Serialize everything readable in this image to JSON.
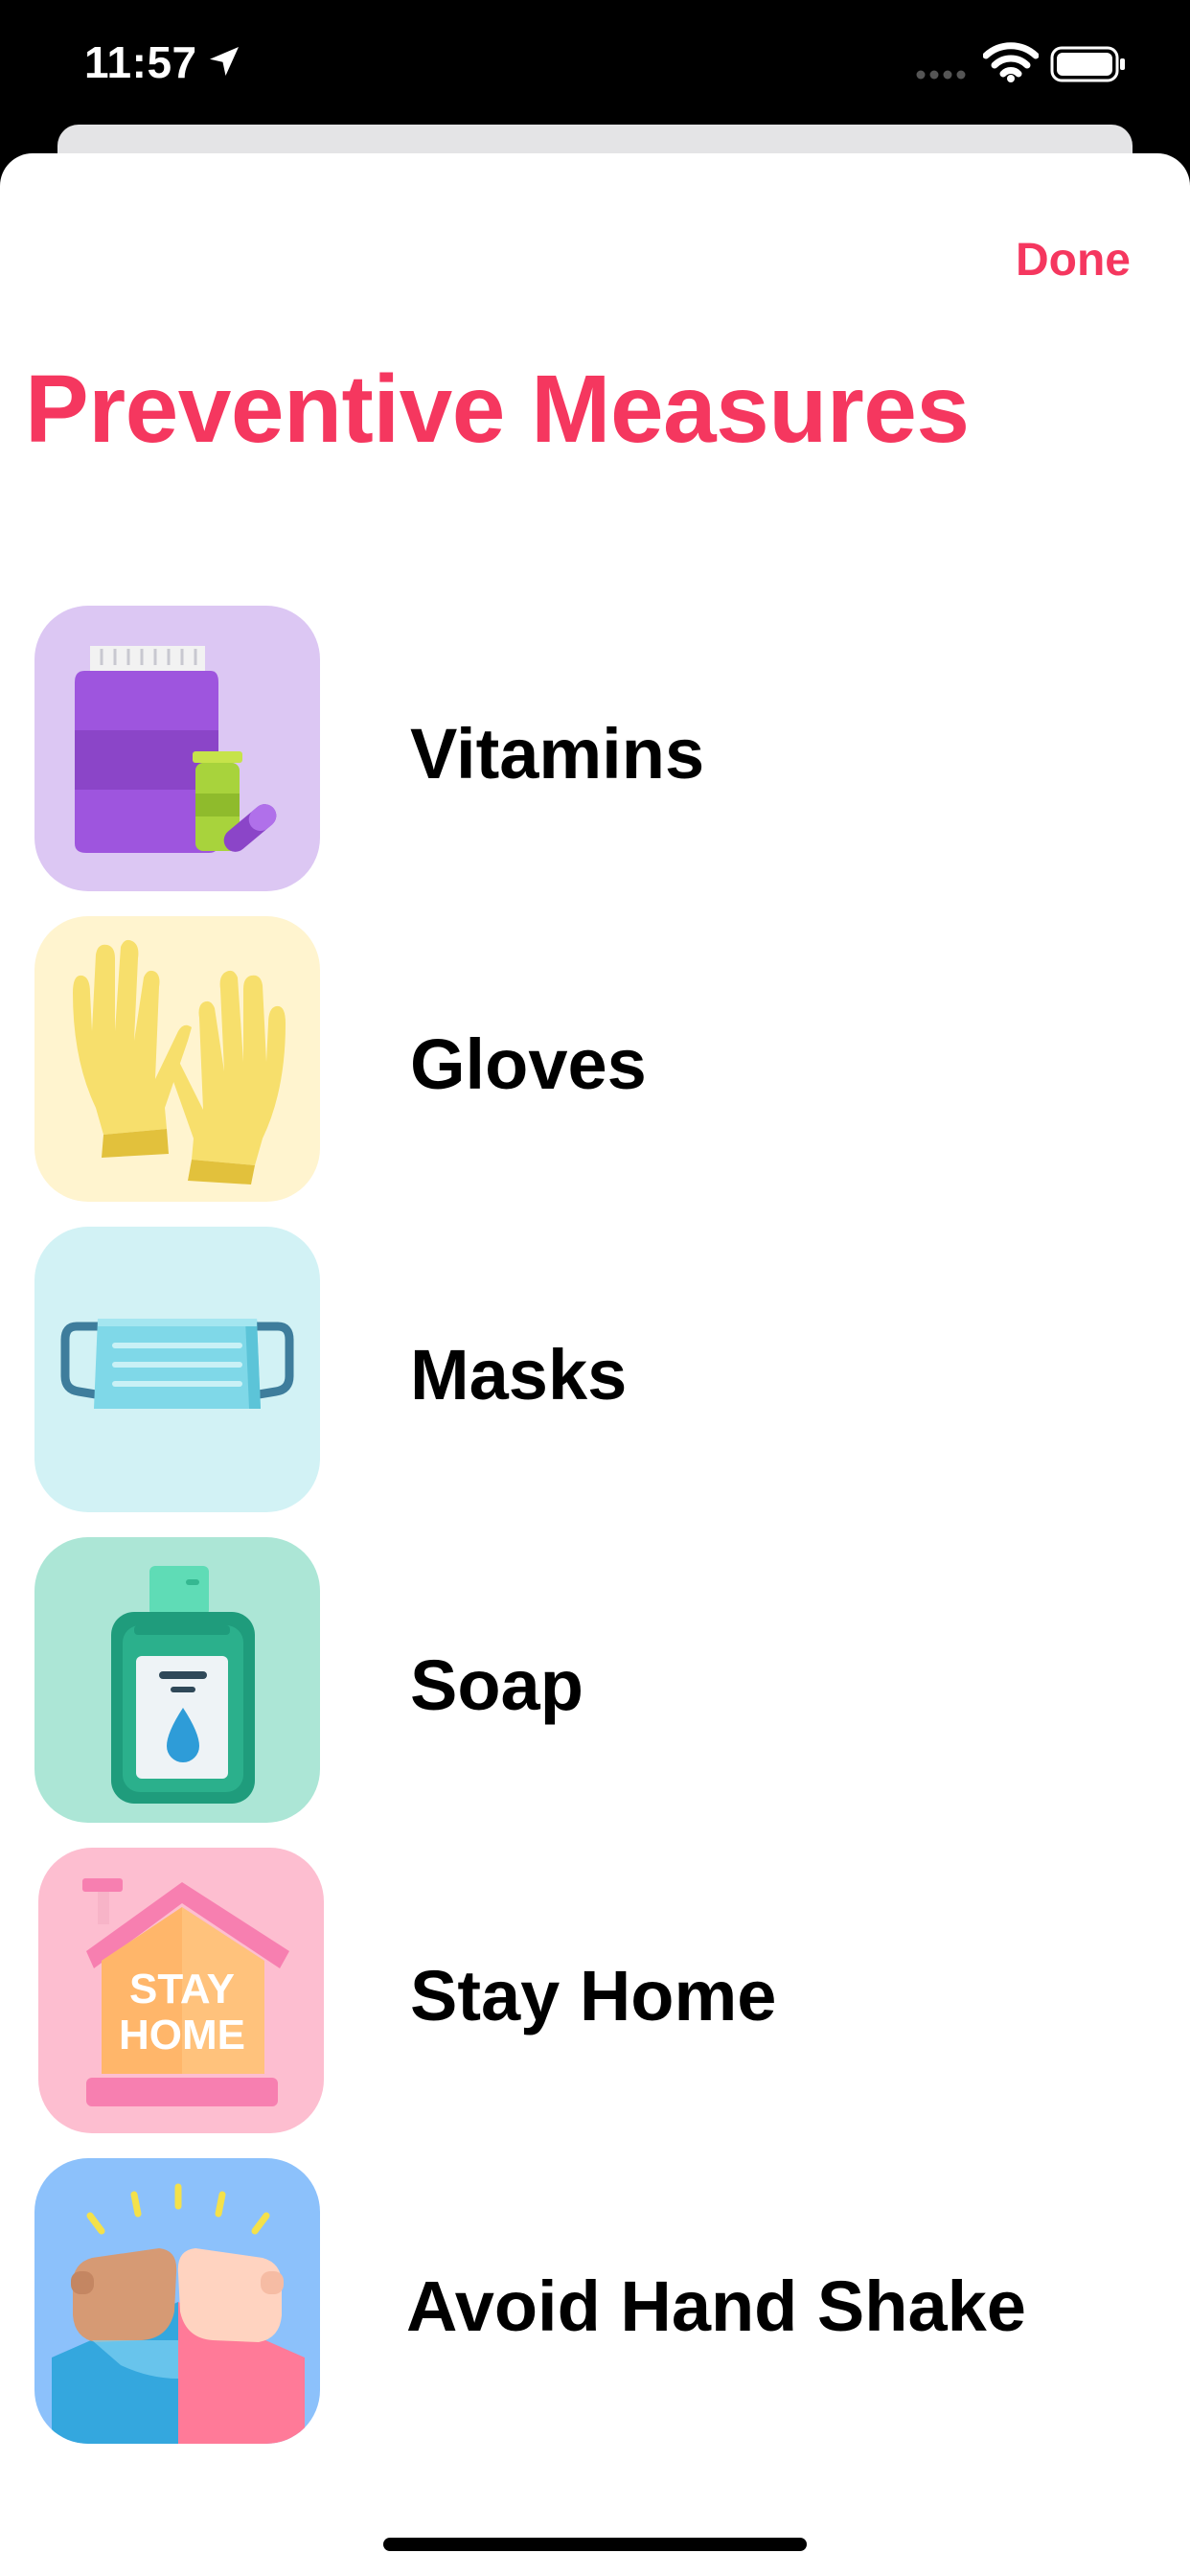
{
  "status_bar": {
    "time": "11:57",
    "icons": [
      "location-arrow-icon",
      "cellular-signal-icon",
      "wifi-icon",
      "battery-icon"
    ]
  },
  "header": {
    "done_label": "Done",
    "title": "Preventive Measures"
  },
  "colors": {
    "accent": "#f5375f",
    "text": "#000000"
  },
  "items": [
    {
      "label": "Vitamins",
      "icon": "vitamins-icon",
      "tile_color": "#dcc7f3"
    },
    {
      "label": "Gloves",
      "icon": "gloves-icon",
      "tile_color": "#fff4cf"
    },
    {
      "label": "Masks",
      "icon": "mask-icon",
      "tile_color": "#d2f2f5"
    },
    {
      "label": "Soap",
      "icon": "soap-bottle-icon",
      "tile_color": "#ace6d6"
    },
    {
      "label": "Stay Home",
      "icon": "stay-home-icon",
      "tile_color": "#fdbed0",
      "icon_text": "STAY HOME"
    },
    {
      "label": "Avoid Hand Shake",
      "icon": "avoid-handshake-icon",
      "tile_color": "#8cc1fb"
    }
  ]
}
